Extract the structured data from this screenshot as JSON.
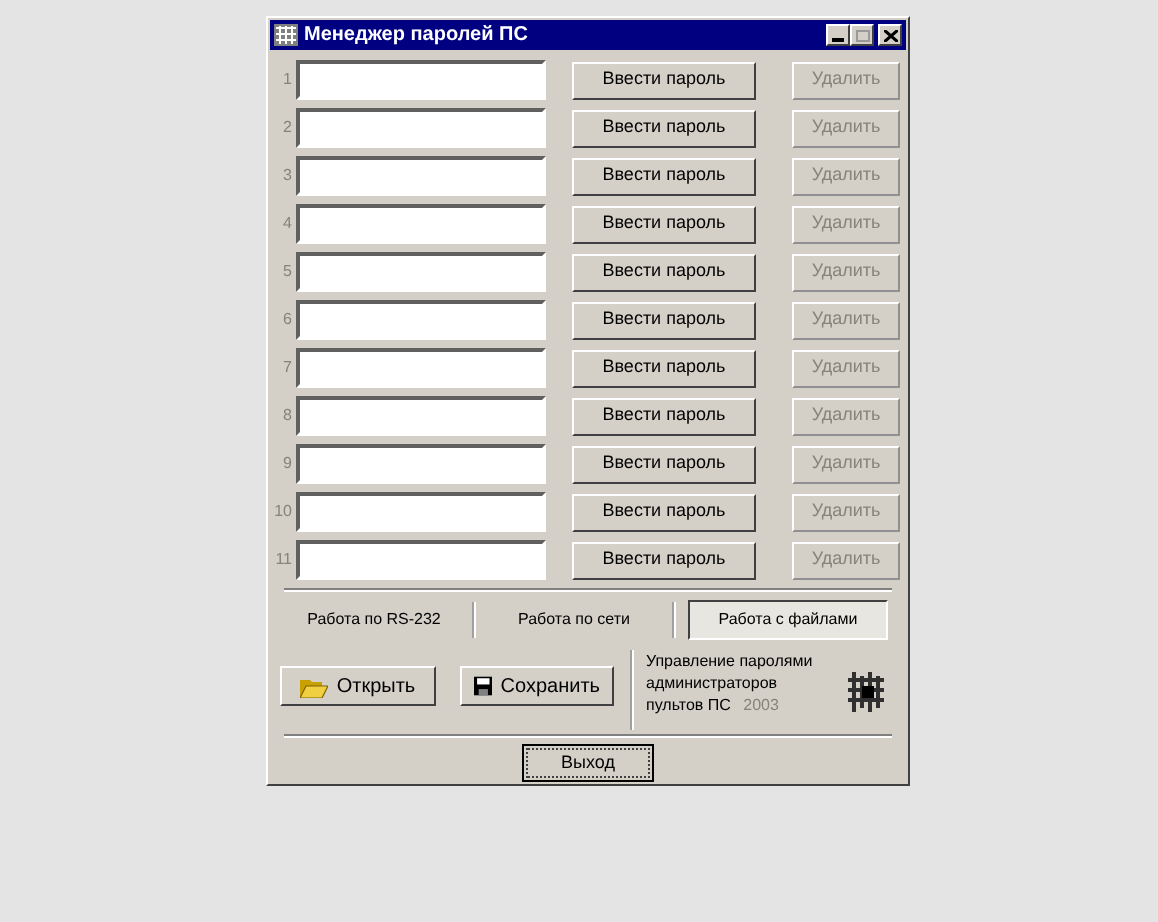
{
  "window": {
    "title": "Менеджер паролей ПС"
  },
  "rows": [
    {
      "number": "1",
      "button": "Ввести пароль",
      "delete": "Удалить",
      "delete_disabled": true
    },
    {
      "number": "2",
      "button": "Ввести пароль",
      "delete": "Удалить",
      "delete_disabled": true
    },
    {
      "number": "3",
      "button": "Ввести пароль",
      "delete": "Удалить",
      "delete_disabled": true
    },
    {
      "number": "4",
      "button": "Ввести пароль",
      "delete": "Удалить",
      "delete_disabled": true
    },
    {
      "number": "5",
      "button": "Ввести пароль",
      "delete": "Удалить",
      "delete_disabled": true
    },
    {
      "number": "6",
      "button": "Ввести пароль",
      "delete": "Удалить",
      "delete_disabled": true
    },
    {
      "number": "7",
      "button": "Ввести пароль",
      "delete": "Удалить",
      "delete_disabled": true
    },
    {
      "number": "8",
      "button": "Ввести пароль",
      "delete": "Удалить",
      "delete_disabled": true
    },
    {
      "number": "9",
      "button": "Ввести пароль",
      "delete": "Удалить",
      "delete_disabled": true
    },
    {
      "number": "10",
      "button": "Ввести пароль",
      "delete": "Удалить",
      "delete_disabled": true
    },
    {
      "number": "11",
      "button": "Ввести пароль",
      "delete": "Удалить",
      "delete_disabled": true
    }
  ],
  "tabs": [
    {
      "label": "Работа по RS-232",
      "selected": false
    },
    {
      "label": "Работа по сети",
      "selected": false
    },
    {
      "label": "Работа с файлами",
      "selected": true
    }
  ],
  "buttons": [
    {
      "kind": "open",
      "label": "Открыть"
    },
    {
      "kind": "save",
      "label": "Сохранить"
    }
  ],
  "about": {
    "text": "Управление паролями администраторов пультов ПС",
    "year": "2003"
  },
  "exit_button": "Выход"
}
